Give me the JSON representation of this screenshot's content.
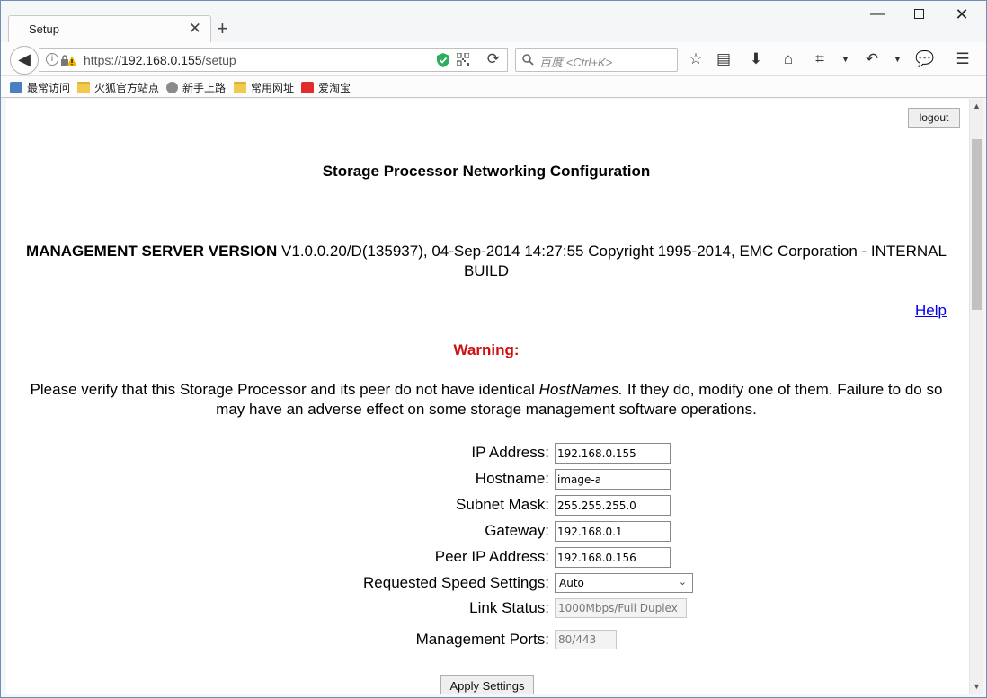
{
  "browser": {
    "tab_title": "Setup",
    "url_prefix": "https://",
    "url_host": "192.168.0.155",
    "url_path": "/setup",
    "search_placeholder": "百度 <Ctrl+K>",
    "bookmarks": [
      "最常访问",
      "火狐官方站点",
      "新手上路",
      "常用网址",
      "爱淘宝"
    ]
  },
  "page": {
    "logout_label": "logout",
    "heading": "Storage Processor Networking Configuration",
    "version_label": "MANAGEMENT SERVER VERSION",
    "version_text": " V1.0.0.20/D(135937), 04-Sep-2014 14:27:55 Copyright 1995-2014, EMC Corporation - INTERNAL BUILD",
    "help_label": "Help",
    "warning_title": "Warning:",
    "warning_pre": "Please verify that this Storage Processor and its peer do not have identical ",
    "warning_em": "HostNames.",
    "warning_post": " If they do, modify one of them. Failure to do so may have an adverse effect on some storage management software operations.",
    "apply_label": "Apply Settings"
  },
  "form": {
    "ip_label": "IP Address:",
    "ip_value": "192.168.0.155",
    "hostname_label": "Hostname:",
    "hostname_value": "image-a",
    "subnet_label": "Subnet Mask:",
    "subnet_value": "255.255.255.0",
    "gateway_label": "Gateway:",
    "gateway_value": "192.168.0.1",
    "peer_label": "Peer IP Address:",
    "peer_value": "192.168.0.156",
    "speed_label": "Requested Speed Settings:",
    "speed_value": "Auto",
    "link_label": "Link Status:",
    "link_value": "1000Mbps/Full Duplex",
    "ports_label": "Management Ports:",
    "ports_value": "80/443"
  }
}
